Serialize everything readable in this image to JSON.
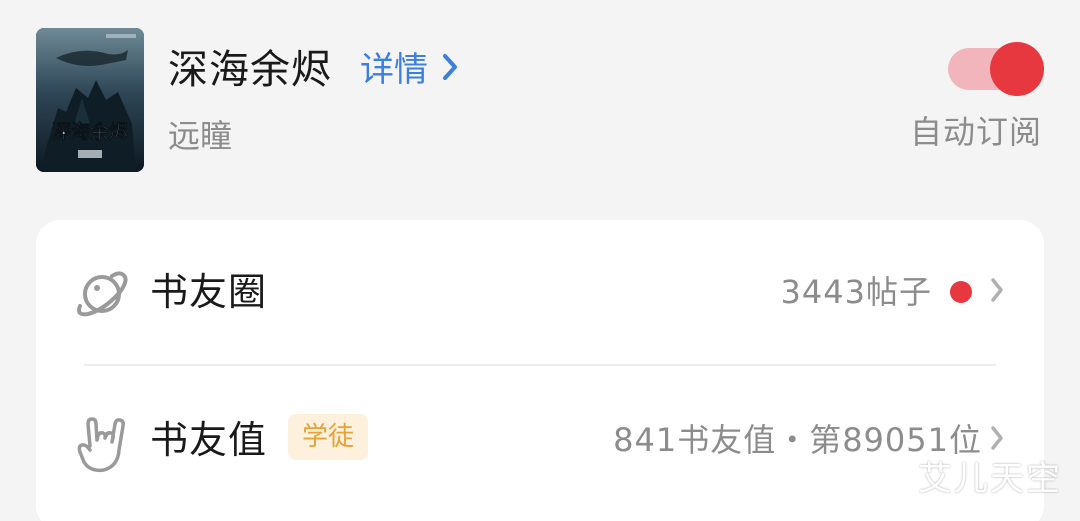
{
  "header": {
    "book_title": "深海余烬",
    "details_label": "详情",
    "author": "远瞳",
    "auto_subscribe_label": "自动订阅",
    "auto_subscribe_on": true
  },
  "rows": [
    {
      "icon": "planet-icon",
      "label": "书友圈",
      "right_text": "3443帖子",
      "has_unread_dot": true
    },
    {
      "icon": "rock-hand-icon",
      "label": "书友值",
      "badge": "学徒",
      "right_text": "841书友值・第89051位"
    }
  ],
  "watermark": "艾儿天空",
  "colors": {
    "accent_blue": "#3d7fe0",
    "toggle_red": "#e8383f",
    "toggle_track": "#f2b5bb",
    "badge_bg": "#fdf0dc",
    "badge_text": "#e8a23a"
  }
}
